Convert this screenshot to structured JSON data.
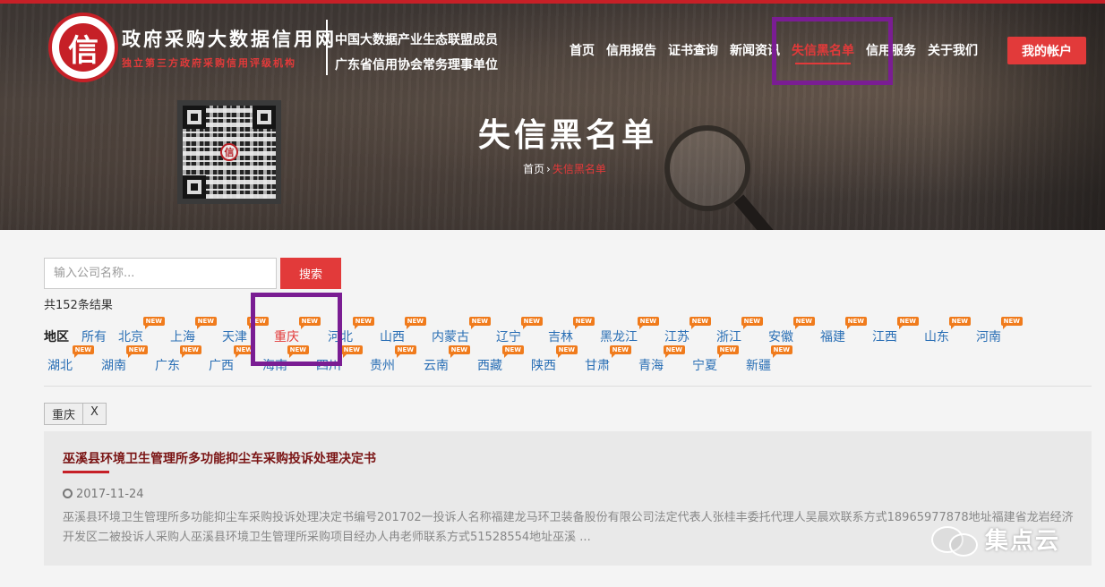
{
  "site": {
    "title": "政府采购大数据信用网",
    "subtitle": "独立第三方政府采购信用评级机构",
    "seal_char": "信",
    "tagline_1": "中国大数据产业生态联盟成员",
    "tagline_2": "广东省信用协会常务理事单位"
  },
  "nav": {
    "items": [
      {
        "label": "首页"
      },
      {
        "label": "信用报告"
      },
      {
        "label": "证书查询"
      },
      {
        "label": "新闻资讯"
      },
      {
        "label": "失信黑名单",
        "active": true
      },
      {
        "label": "信用服务"
      },
      {
        "label": "关于我们"
      }
    ],
    "account_label": "我的帐户"
  },
  "hero": {
    "heading": "失信黑名单",
    "breadcrumb_home": "首页",
    "breadcrumb_sep": "›",
    "breadcrumb_current": "失信黑名单"
  },
  "search": {
    "placeholder": "输入公司名称...",
    "button_label": "搜索",
    "results_count": "共152条结果"
  },
  "regions": {
    "label": "地区",
    "badge": "NEW",
    "row1": [
      "所有",
      "北京",
      "上海",
      "天津",
      "重庆",
      "河北",
      "山西",
      "内蒙古",
      "辽宁",
      "吉林",
      "黑龙江",
      "江苏",
      "浙江",
      "安徽",
      "福建",
      "江西",
      "山东",
      "河南"
    ],
    "row2": [
      "湖北",
      "湖南",
      "广东",
      "广西",
      "海南",
      "四川",
      "贵州",
      "云南",
      "西藏",
      "陕西",
      "甘肃",
      "青海",
      "宁夏",
      "新疆"
    ],
    "active": "重庆"
  },
  "filter": {
    "tag": "重庆",
    "remove": "X"
  },
  "results": [
    {
      "title": "巫溪县环境卫生管理所多功能抑尘车采购投诉处理决定书",
      "date": "2017-11-24",
      "summary": "巫溪县环境卫生管理所多功能抑尘车采购投诉处理决定书编号201702一投诉人名称福建龙马环卫装备股份有限公司法定代表人张桂丰委托代理人吴晨欢联系方式18965977878地址福建省龙岩经济开发区二被投诉人采购人巫溪县环境卫生管理所采购项目经办人冉老师联系方式51528554地址巫溪 ..."
    }
  ],
  "watermark": {
    "text": "集点云"
  },
  "colors": {
    "brand_red": "#e23a3a",
    "link_blue": "#2a6fb5",
    "highlight_purple": "#7a1d93",
    "badge_orange": "#f07b1c"
  }
}
